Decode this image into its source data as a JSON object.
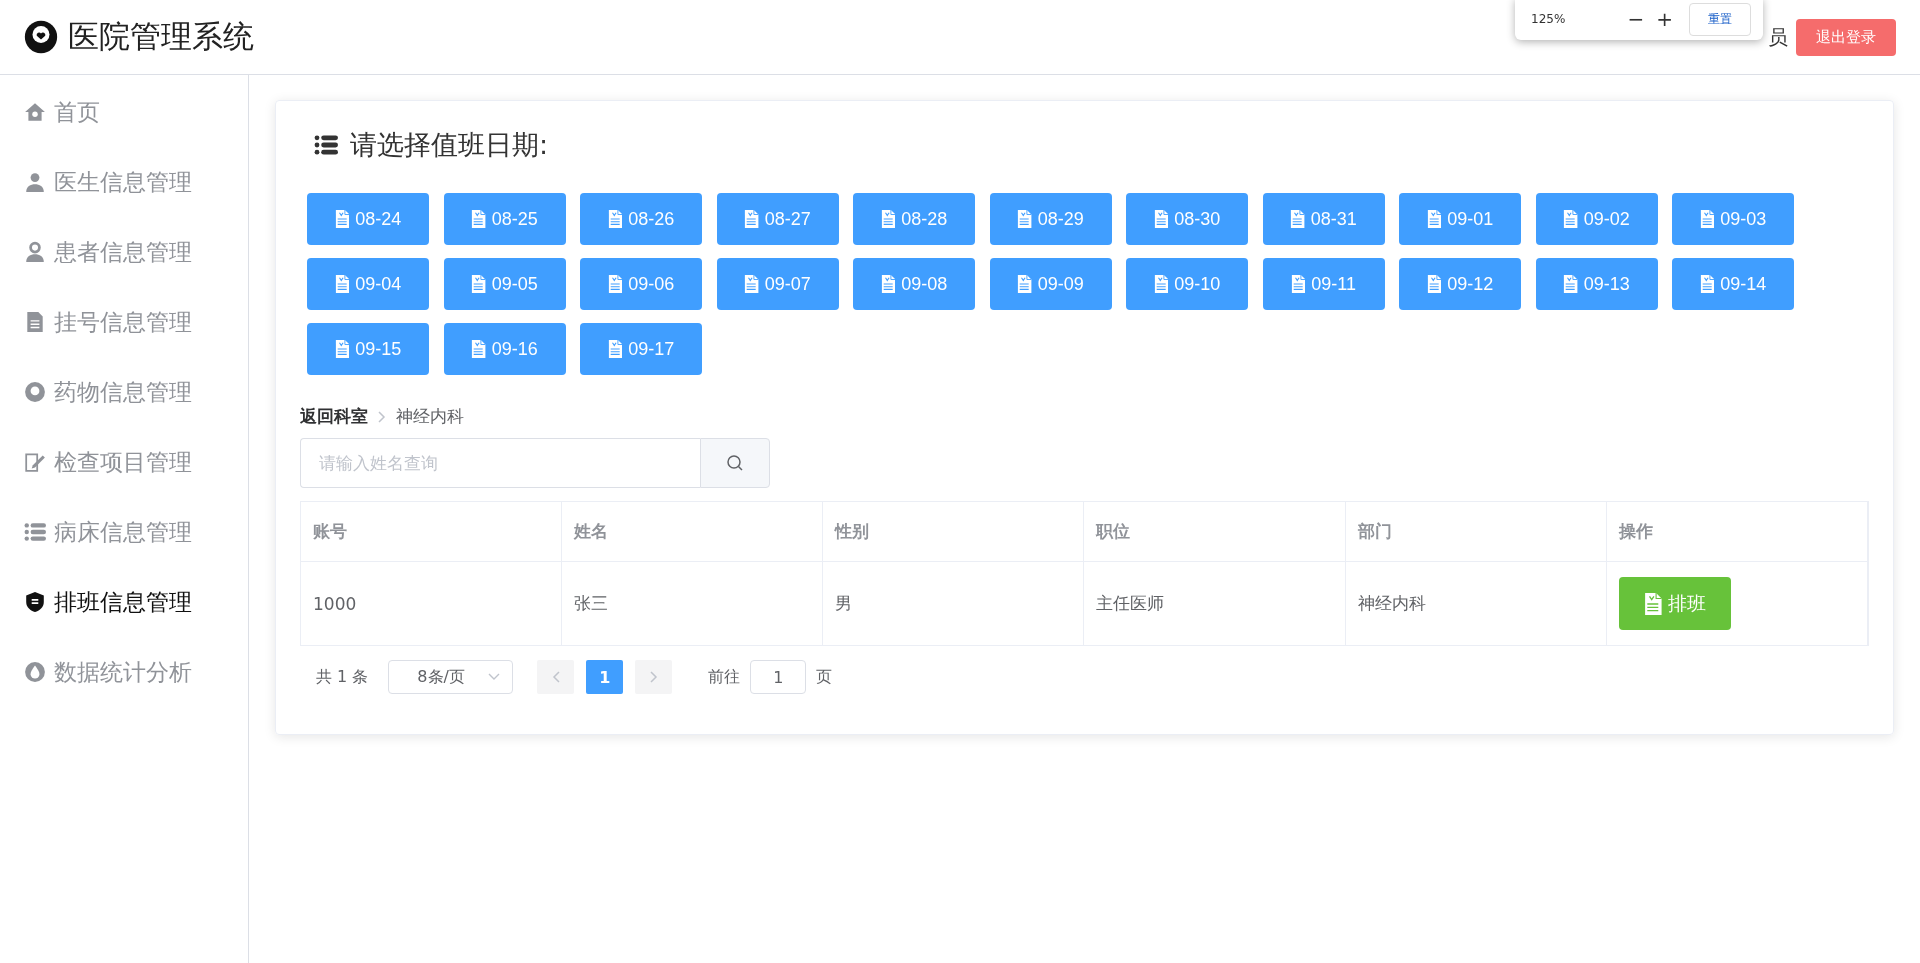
{
  "header": {
    "title": "医院管理系统",
    "greeting": "员",
    "logout": "退出登录"
  },
  "zoom_popup": {
    "level": "125%",
    "minus": "−",
    "plus": "+",
    "reset": "重置"
  },
  "sidebar": {
    "items": [
      {
        "label": "首页",
        "kind": "home",
        "selected": false
      },
      {
        "label": "医生信息管理",
        "kind": "doctor",
        "selected": false
      },
      {
        "label": "患者信息管理",
        "kind": "patient",
        "selected": false
      },
      {
        "label": "挂号信息管理",
        "kind": "doc",
        "selected": false
      },
      {
        "label": "药物信息管理",
        "kind": "medicine",
        "selected": false
      },
      {
        "label": "检查项目管理",
        "kind": "edit",
        "selected": false
      },
      {
        "label": "病床信息管理",
        "kind": "list",
        "selected": false
      },
      {
        "label": "排班信息管理",
        "kind": "shield",
        "selected": true
      },
      {
        "label": "数据统计分析",
        "kind": "drop",
        "selected": false
      }
    ]
  },
  "section_title": "请选择值班日期:",
  "dates": [
    "08-24",
    "08-25",
    "08-26",
    "08-27",
    "08-28",
    "08-29",
    "08-30",
    "08-31",
    "09-01",
    "09-02",
    "09-03",
    "09-04",
    "09-05",
    "09-06",
    "09-07",
    "09-08",
    "09-09",
    "09-10",
    "09-11",
    "09-12",
    "09-13",
    "09-14",
    "09-15",
    "09-16",
    "09-17"
  ],
  "breadcrumb": [
    "返回科室",
    "神经内科"
  ],
  "search": {
    "placeholder": "请输入姓名查询"
  },
  "table": {
    "columns": [
      "账号",
      "姓名",
      "性别",
      "职位",
      "部门",
      "操作"
    ],
    "rows": [
      {
        "cells": [
          "1000",
          "张三",
          "男",
          "主任医师",
          "神经内科"
        ],
        "action": "排班"
      }
    ]
  },
  "pagination": {
    "total": "共 1 条",
    "page_size": "8条/页",
    "pages": [
      {
        "label": "1",
        "selected": true
      }
    ],
    "goto_label": "前往",
    "goto_value": "1",
    "goto_suffix": "页"
  }
}
